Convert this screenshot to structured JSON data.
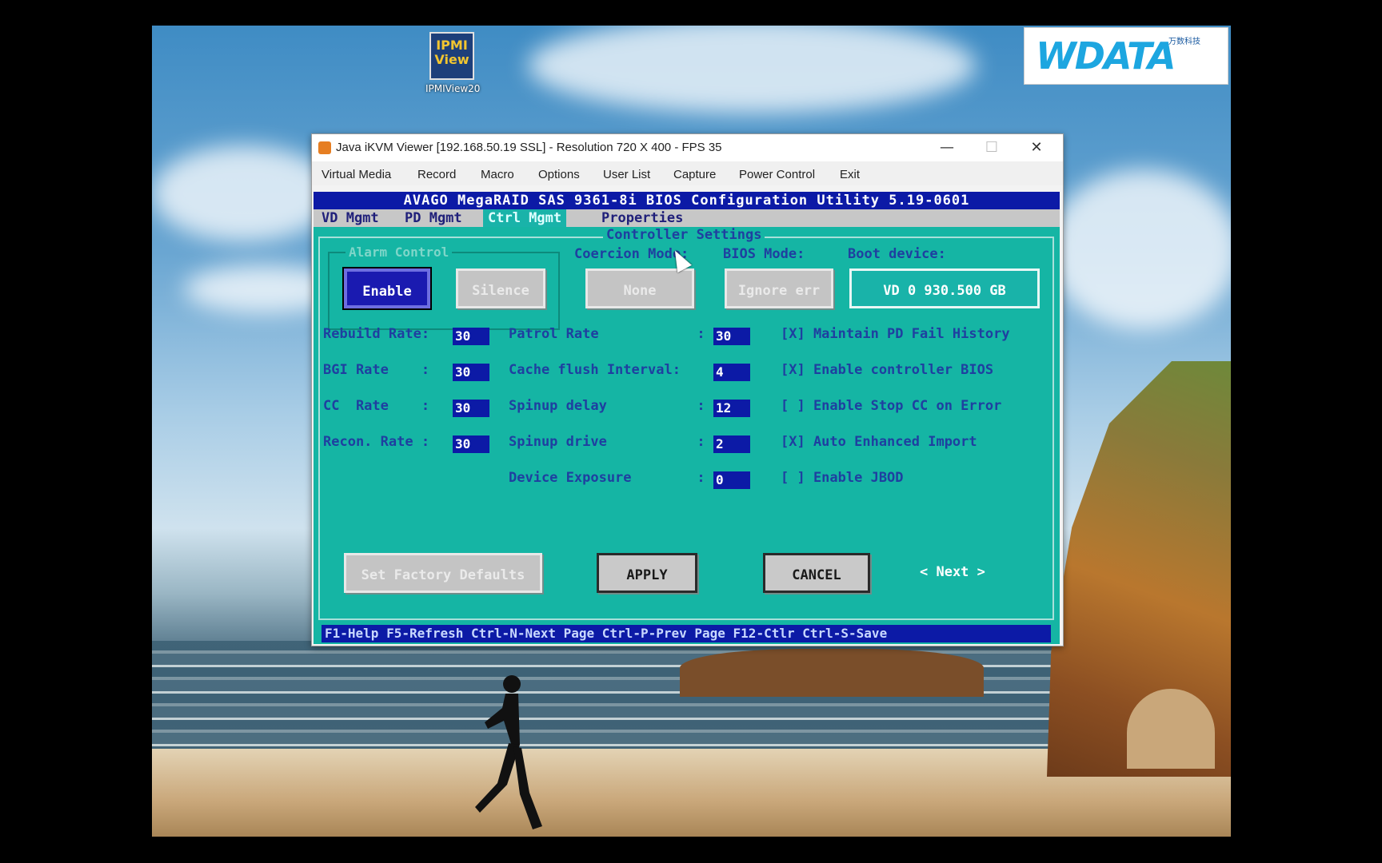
{
  "desktop_icon": {
    "art_text": "IPMI View",
    "label": "IPMIView20"
  },
  "logo": {
    "text": "WDATA",
    "subtext": "万数科技"
  },
  "window": {
    "title": "Java iKVM Viewer  [192.168.50.19 SSL]  - Resolution 720 X 400 - FPS 35",
    "minimize": "—",
    "maximize": "☐",
    "close": "✕",
    "menu": [
      "Virtual Media",
      "Record",
      "Macro",
      "Options",
      "User List",
      "Capture",
      "Power Control",
      "Exit"
    ]
  },
  "bios": {
    "header": "AVAGO MegaRAID SAS 9361-8i BIOS Configuration Utility 5.19-0601",
    "tabs": [
      "VD Mgmt",
      "PD Mgmt",
      "Ctrl Mgmt",
      "Properties"
    ],
    "active_tab": "Ctrl Mgmt",
    "frame_title": "Controller Settings",
    "alarm_control": {
      "title": "Alarm Control",
      "enable": "Enable",
      "silence": "Silence"
    },
    "coercion_mode": {
      "label": "Coercion Mode:",
      "value": "None"
    },
    "bios_mode": {
      "label": "BIOS Mode:",
      "value": "Ignore err"
    },
    "boot_device": {
      "label": "Boot device:",
      "value": "VD  0 930.500 GB"
    },
    "rates": [
      {
        "label": "Rebuild Rate:",
        "value": "30"
      },
      {
        "label": "BGI Rate    :",
        "value": "30"
      },
      {
        "label": "CC  Rate    :",
        "value": "30"
      },
      {
        "label": "Recon. Rate :",
        "value": "30"
      }
    ],
    "settings": [
      {
        "label": "Patrol Rate            :",
        "value": "30"
      },
      {
        "label": "Cache flush Interval:",
        "value": "4"
      },
      {
        "label": "Spinup delay           :",
        "value": "12"
      },
      {
        "label": "Spinup drive           :",
        "value": "2"
      },
      {
        "label": "Device Exposure        :",
        "value": "0"
      }
    ],
    "checkboxes": [
      {
        "text": "[X] Maintain PD Fail History",
        "checked": true
      },
      {
        "text": "[X] Enable controller BIOS",
        "checked": true
      },
      {
        "text": "[ ] Enable Stop CC on Error",
        "checked": false
      },
      {
        "text": "[X] Auto Enhanced Import",
        "checked": true
      },
      {
        "text": "[ ] Enable JBOD",
        "checked": false
      }
    ],
    "buttons": {
      "factory": "Set Factory Defaults",
      "apply": "APPLY",
      "cancel": "CANCEL",
      "next": "< Next >"
    },
    "status_bar": "F1-Help F5-Refresh Ctrl-N-Next Page Ctrl-P-Prev Page F12-Ctlr Ctrl-S-Save"
  },
  "colors": {
    "bios_bg": "#15b5a4",
    "bios_blue": "#0c1aa6",
    "label_blue": "#1f3fa0"
  }
}
